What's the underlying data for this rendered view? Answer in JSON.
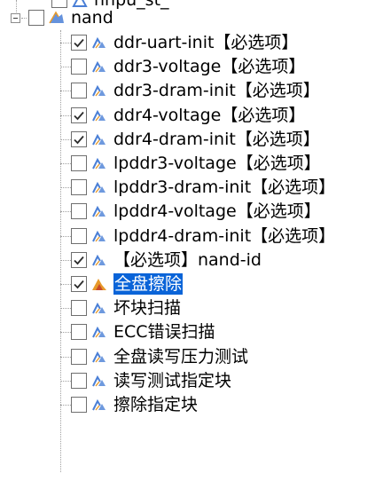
{
  "top_partial_label": "nnpu_st_",
  "root": {
    "label": "nand",
    "expanded": true
  },
  "items": [
    {
      "label": "ddr-uart-init【必选项】",
      "checked": true,
      "selected": false,
      "icon": "warning-icon"
    },
    {
      "label": "ddr3-voltage【必选项】",
      "checked": false,
      "selected": false,
      "icon": "warning-icon"
    },
    {
      "label": "ddr3-dram-init【必选项】",
      "checked": false,
      "selected": false,
      "icon": "warning-icon"
    },
    {
      "label": "ddr4-voltage【必选项】",
      "checked": true,
      "selected": false,
      "icon": "warning-icon"
    },
    {
      "label": "ddr4-dram-init【必选项】",
      "checked": true,
      "selected": false,
      "icon": "warning-icon"
    },
    {
      "label": "lpddr3-voltage【必选项】",
      "checked": false,
      "selected": false,
      "icon": "warning-icon"
    },
    {
      "label": "lpddr3-dram-init【必选项】",
      "checked": false,
      "selected": false,
      "icon": "warning-icon"
    },
    {
      "label": "lpddr4-voltage【必选项】",
      "checked": false,
      "selected": false,
      "icon": "warning-icon"
    },
    {
      "label": "lpddr4-dram-init【必选项】",
      "checked": false,
      "selected": false,
      "icon": "warning-icon"
    },
    {
      "label": "【必选项】nand-id",
      "checked": true,
      "selected": false,
      "icon": "warning-icon"
    },
    {
      "label": "全盘擦除",
      "checked": true,
      "selected": true,
      "icon": "warning-icon"
    },
    {
      "label": "坏块扫描",
      "checked": false,
      "selected": false,
      "icon": "warning-icon"
    },
    {
      "label": "ECC错误扫描",
      "checked": false,
      "selected": false,
      "icon": "warning-icon"
    },
    {
      "label": "全盘读写压力测试",
      "checked": false,
      "selected": false,
      "icon": "warning-icon"
    },
    {
      "label": "读写测试指定块",
      "checked": false,
      "selected": false,
      "icon": "warning-icon"
    },
    {
      "label": "擦除指定块",
      "checked": false,
      "selected": false,
      "icon": "warning-icon"
    }
  ],
  "colors": {
    "selection_bg": "#0a64d8",
    "selection_text": "#ffffff",
    "check_mark": "#2c2c2c",
    "icon_blue": "#4a7fd6",
    "icon_orange": "#e79a2a"
  }
}
